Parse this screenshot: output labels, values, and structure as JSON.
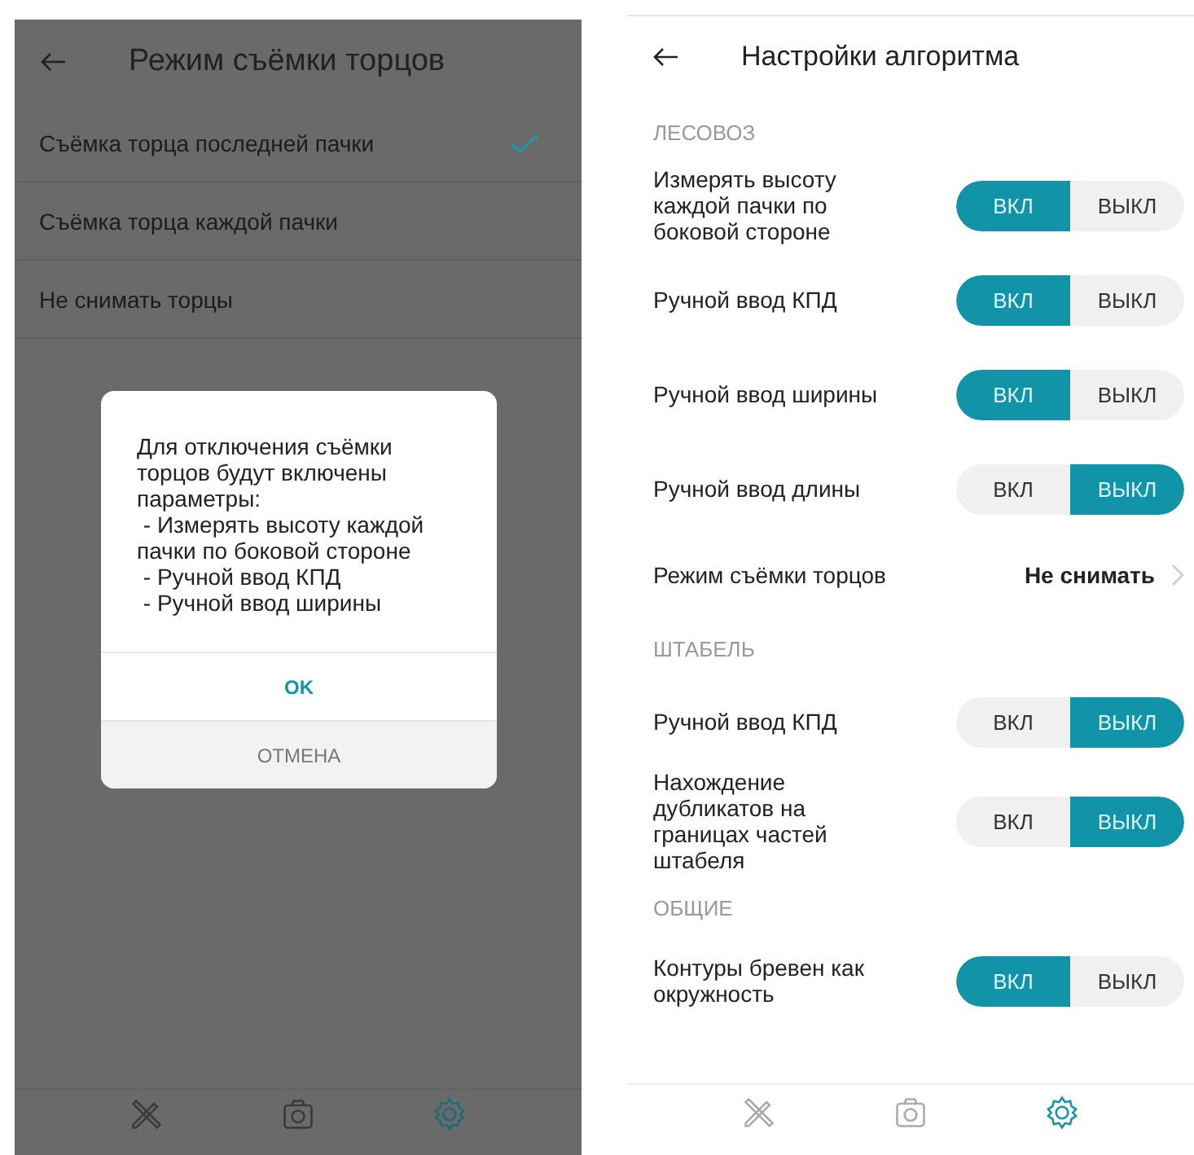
{
  "left_screen": {
    "title": "Режим съёмки торцов",
    "options": [
      {
        "label": "Съёмка торца последней пачки",
        "selected": true
      },
      {
        "label": "Съёмка торца каждой пачки",
        "selected": false
      },
      {
        "label": "Не снимать торцы",
        "selected": false
      }
    ],
    "dialog": {
      "message": "Для отключения съёмки торцов будут включены параметры:\n - Измерять высоту каждой пачки по боковой стороне\n - Ручной ввод КПД\n - Ручной ввод ширины",
      "ok": "OK",
      "cancel": "ОТМЕНА"
    },
    "tabs": [
      {
        "kind": "tools",
        "selected": false
      },
      {
        "kind": "camera",
        "selected": false
      },
      {
        "kind": "settings",
        "selected": true
      }
    ]
  },
  "right_screen": {
    "title": "Настройки алгоритма",
    "sections": [
      {
        "heading": "ЛЕСОВОЗ",
        "rows": [
          {
            "kind": "toggle",
            "label": "Измерять высоту каждой пачки по боковой стороне",
            "on_label": "ВКЛ",
            "off_label": "ВЫКЛ",
            "on": true
          },
          {
            "kind": "toggle",
            "label": "Ручной ввод КПД",
            "on_label": "ВКЛ",
            "off_label": "ВЫКЛ",
            "on": true
          },
          {
            "kind": "toggle",
            "label": "Ручной ввод ширины",
            "on_label": "ВКЛ",
            "off_label": "ВЫКЛ",
            "on": true
          },
          {
            "kind": "toggle",
            "label": "Ручной ввод длины",
            "on_label": "ВКЛ",
            "off_label": "ВЫКЛ",
            "on": false
          },
          {
            "kind": "link",
            "label": "Режим съёмки торцов",
            "value": "Не снимать"
          }
        ]
      },
      {
        "heading": "ШТАБЕЛЬ",
        "rows": [
          {
            "kind": "toggle",
            "label": "Ручной ввод КПД",
            "on_label": "ВКЛ",
            "off_label": "ВЫКЛ",
            "on": false
          },
          {
            "kind": "toggle",
            "label": "Нахождение дубликатов на границах частей штабеля",
            "on_label": "ВКЛ",
            "off_label": "ВЫКЛ",
            "on": false
          }
        ]
      },
      {
        "heading": "ОБЩИЕ",
        "rows": [
          {
            "kind": "toggle",
            "label": "Контуры бревен как окружность",
            "on_label": "ВКЛ",
            "off_label": "ВЫКЛ",
            "on": true
          }
        ]
      }
    ],
    "tabs": [
      {
        "kind": "tools",
        "selected": false
      },
      {
        "kind": "camera",
        "selected": false
      },
      {
        "kind": "settings",
        "selected": true
      }
    ]
  }
}
